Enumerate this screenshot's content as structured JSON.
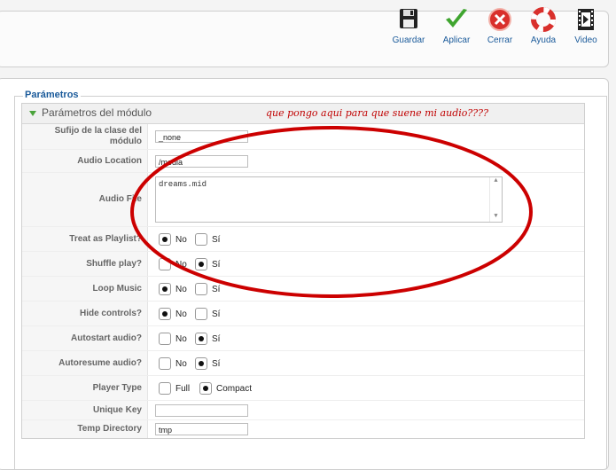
{
  "toolbar": {
    "buttons": [
      {
        "label": "Guardar",
        "icon": "floppy-disk-icon"
      },
      {
        "label": "Aplicar",
        "icon": "checkmark-icon"
      },
      {
        "label": "Cerrar",
        "icon": "close-icon"
      },
      {
        "label": "Ayuda",
        "icon": "lifebuoy-icon"
      },
      {
        "label": "Video",
        "icon": "film-icon"
      }
    ]
  },
  "params": {
    "legend": "Parámetros",
    "module_title": "Parámetros del módulo"
  },
  "fields": {
    "suffix": {
      "label": "Sufijo de la clase del módulo",
      "value": "_none"
    },
    "audio_location": {
      "label": "Audio Location",
      "value": "/media"
    },
    "audio_file": {
      "label": "Audio File",
      "value": "dreams.mid"
    },
    "treat_playlist": {
      "label": "Treat as Playlist?",
      "opt1": "No",
      "opt2": "Sí",
      "selected": "No"
    },
    "shuffle": {
      "label": "Shuffle play?",
      "opt1": "No",
      "opt2": "Sí",
      "selected": "Sí"
    },
    "loop": {
      "label": "Loop Music",
      "opt1": "No",
      "opt2": "Sí",
      "selected": "No"
    },
    "hide_controls": {
      "label": "Hide controls?",
      "opt1": "No",
      "opt2": "Sí",
      "selected": "No"
    },
    "autostart": {
      "label": "Autostart audio?",
      "opt1": "No",
      "opt2": "Sí",
      "selected": "Sí"
    },
    "autoresume": {
      "label": "Autoresume audio?",
      "opt1": "No",
      "opt2": "Sí",
      "selected": "Sí"
    },
    "player_type": {
      "label": "Player Type",
      "opt1": "Full",
      "opt2": "Compact",
      "selected": "Compact"
    },
    "unique_key": {
      "label": "Unique Key",
      "value": ""
    },
    "temp_dir": {
      "label": "Temp Directory",
      "value": "tmp"
    }
  },
  "annotation": {
    "text": "que pongo aqui para que suene mi audio????",
    "color": "#cc0000"
  },
  "colors": {
    "link_blue": "#1a5a9a",
    "accent_green": "#4aa33b"
  }
}
